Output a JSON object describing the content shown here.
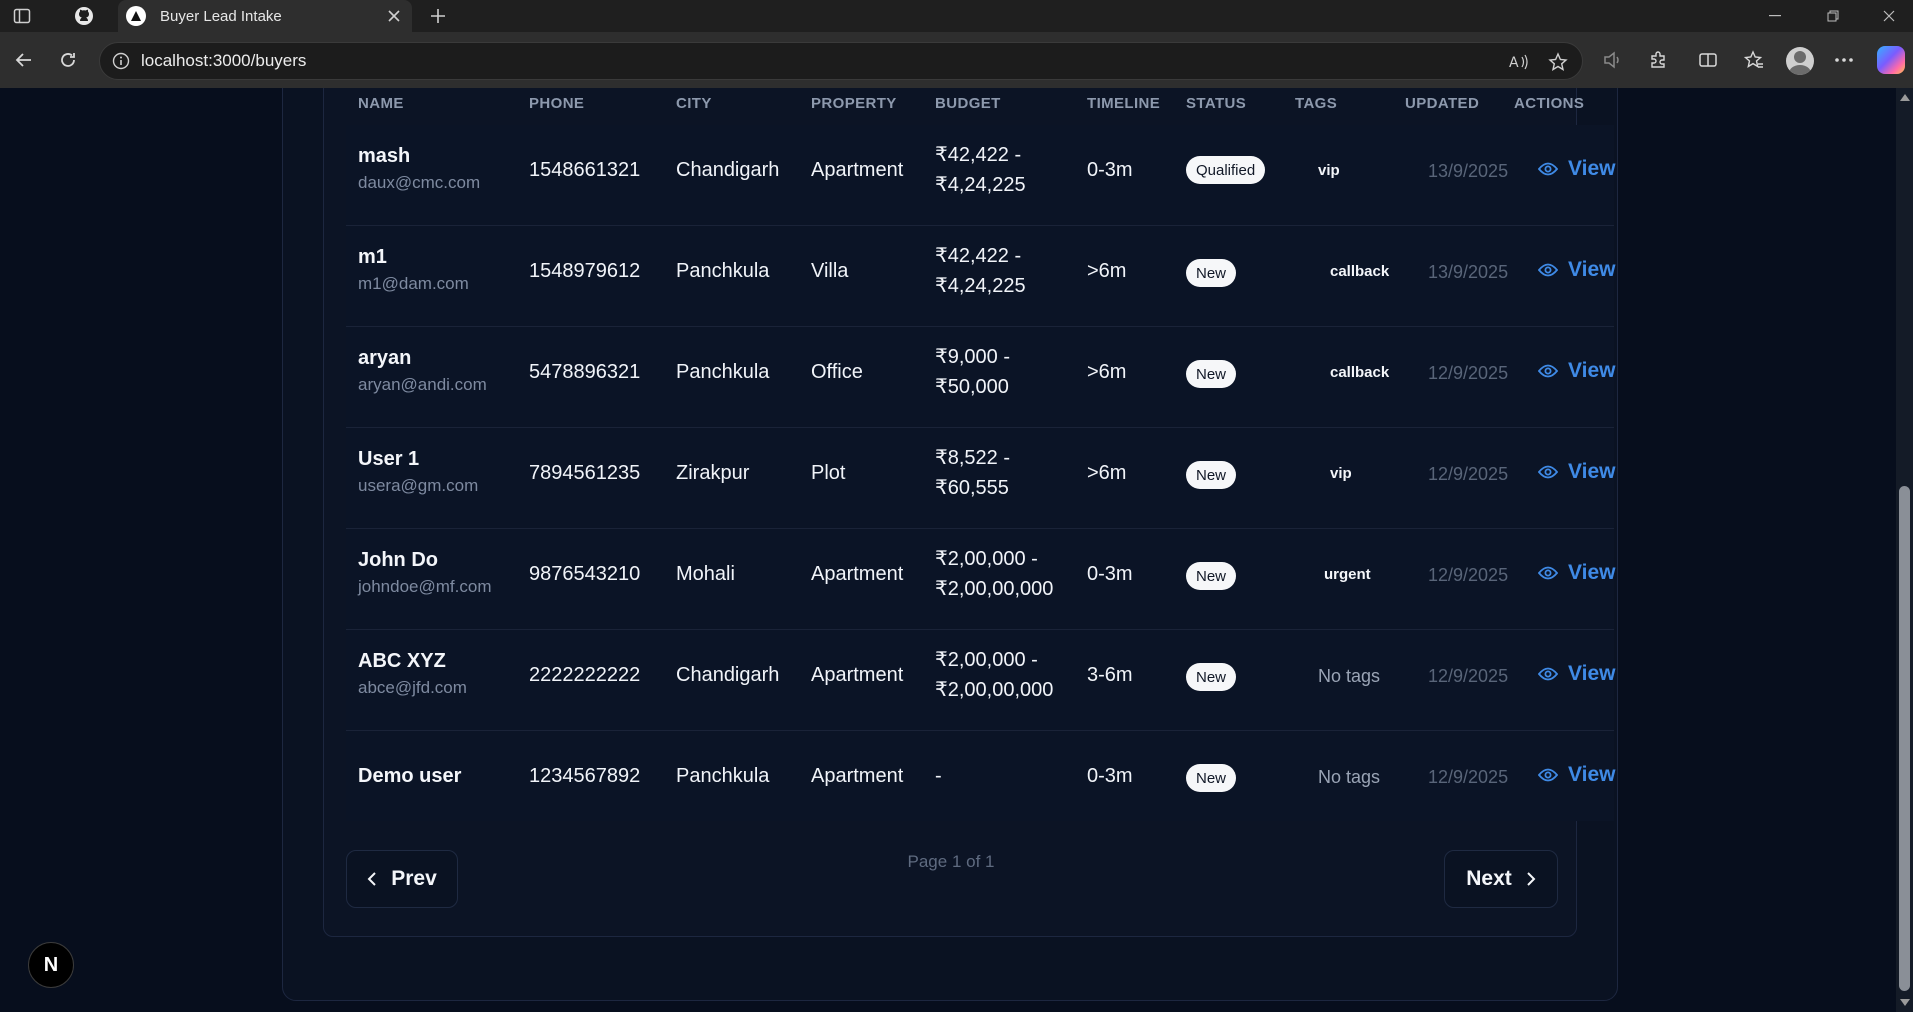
{
  "browser": {
    "tab_title": "Buyer Lead Intake",
    "url": "localhost:3000/buyers"
  },
  "table": {
    "headers": [
      "NAME",
      "PHONE",
      "CITY",
      "PROPERTY",
      "BUDGET",
      "TIMELINE",
      "STATUS",
      "TAGS",
      "UPDATED",
      "ACTIONS"
    ],
    "rows": [
      {
        "name": "mash",
        "email": "daux@cmc.com",
        "phone": "1548661321",
        "city": "Chandigarh",
        "property": "Apartment",
        "budget_min": "₹42,422 -",
        "budget_max": "₹4,24,225",
        "timeline": "0-3m",
        "status": "Qualified",
        "tag": "vip",
        "updated": "13/9/2025",
        "action": "View"
      },
      {
        "name": "m1",
        "email": "m1@dam.com",
        "phone": "1548979612",
        "city": "Panchkula",
        "property": "Villa",
        "budget_min": "₹42,422 -",
        "budget_max": "₹4,24,225",
        "timeline": ">6m",
        "status": "New",
        "tag": "callback",
        "updated": "13/9/2025",
        "action": "View"
      },
      {
        "name": "aryan",
        "email": "aryan@andi.com",
        "phone": "5478896321",
        "city": "Panchkula",
        "property": "Office",
        "budget_min": "₹9,000 -",
        "budget_max": "₹50,000",
        "timeline": ">6m",
        "status": "New",
        "tag": "callback",
        "updated": "12/9/2025",
        "action": "View"
      },
      {
        "name": "User 1",
        "email": "usera@gm.com",
        "phone": "7894561235",
        "city": "Zirakpur",
        "property": "Plot",
        "budget_min": "₹8,522 -",
        "budget_max": "₹60,555",
        "timeline": ">6m",
        "status": "New",
        "tag": "vip",
        "updated": "12/9/2025",
        "action": "View"
      },
      {
        "name": "John Do",
        "email": "johndoe@mf.com",
        "phone": "9876543210",
        "city": "Mohali",
        "property": "Apartment",
        "budget_min": "₹2,00,000 -",
        "budget_max": "₹2,00,00,000",
        "timeline": "0-3m",
        "status": "New",
        "tag": "urgent",
        "updated": "12/9/2025",
        "action": "View"
      },
      {
        "name": "ABC XYZ",
        "email": "abce@jfd.com",
        "phone": "2222222222",
        "city": "Chandigarh",
        "property": "Apartment",
        "budget_min": "₹2,00,000 -",
        "budget_max": "₹2,00,00,000",
        "timeline": "3-6m",
        "status": "New",
        "no_tags": "No tags",
        "updated": "12/9/2025",
        "action": "View"
      },
      {
        "name": "Demo user",
        "phone": "1234567892",
        "city": "Panchkula",
        "property": "Apartment",
        "budget_single": "-",
        "timeline": "0-3m",
        "status": "New",
        "no_tags": "No tags",
        "updated": "12/9/2025",
        "action": "View"
      }
    ]
  },
  "pagination": {
    "prev_label": "Prev",
    "next_label": "Next",
    "page_text": "Page 1 of 1"
  },
  "fab": {
    "label": "N"
  },
  "colors": {
    "page_bg": "#070e1d",
    "card_bg": "#0c1425",
    "accent": "#3f8ae6"
  }
}
